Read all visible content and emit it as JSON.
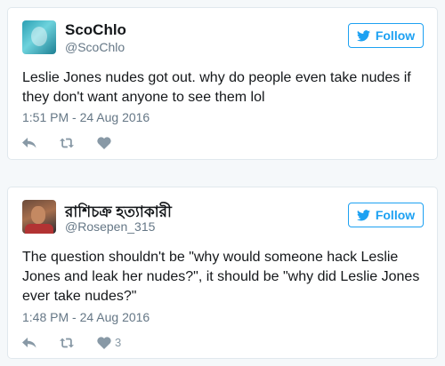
{
  "tweets": [
    {
      "name": "ScoChlo",
      "handle": "@ScoChlo",
      "follow_label": "Follow",
      "text_lines": [
        "Leslie Jones nudes got out. why do people even take nudes if",
        "they don't want anyone to see them lol"
      ],
      "timestamp": "1:51 PM - 24 Aug 2016",
      "like_count": ""
    },
    {
      "name": "রাশিচক্র হত্যাকারী",
      "handle": "@Rosepen_315",
      "follow_label": "Follow",
      "text_lines": [
        "The question shouldn't be \"why would someone hack Leslie",
        "Jones and leak her nudes?\", it should be \"why did Leslie Jones",
        "ever take nudes?\""
      ],
      "timestamp": "1:48 PM - 24 Aug 2016",
      "like_count": "3"
    }
  ],
  "colors": {
    "accent": "#1da1f2",
    "muted": "#657786",
    "icon": "#8899a6",
    "border": "#e1e8ed",
    "background": "#f5f8fa"
  },
  "icons": [
    "twitter-bird-icon",
    "reply-icon",
    "retweet-icon",
    "heart-icon"
  ]
}
